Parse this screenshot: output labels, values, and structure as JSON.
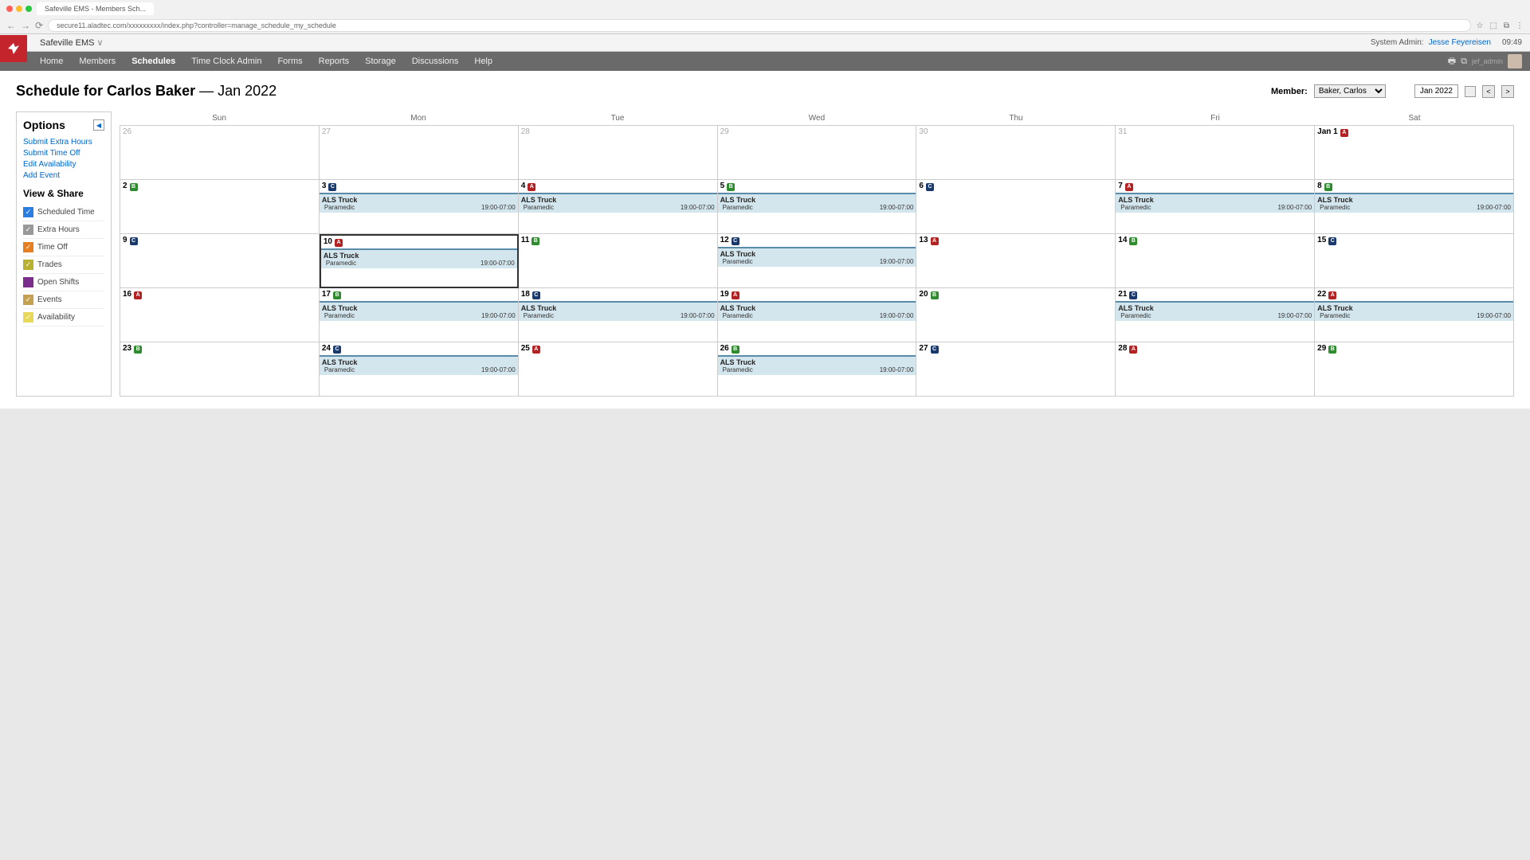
{
  "browser": {
    "tab_title": "Safeville EMS - Members Sch...",
    "url": "secure11.aladtec.com/xxxxxxxxx/index.php?controller=manage_schedule_my_schedule"
  },
  "header": {
    "org_name": "Safeville EMS",
    "system_admin_label": "System Admin:",
    "admin_name": "Jesse Feyereisen",
    "time": "09:49",
    "username_small": "jef_admin"
  },
  "nav": {
    "items": [
      "Home",
      "Members",
      "Schedules",
      "Time Clock Admin",
      "Forms",
      "Reports",
      "Storage",
      "Discussions",
      "Help"
    ],
    "active": "Schedules"
  },
  "page": {
    "title_prefix": "Schedule for Carlos Baker",
    "title_suffix": "— Jan 2022",
    "member_label": "Member:",
    "member_selected": "Baker, Carlos",
    "month_display": "Jan 2022"
  },
  "sidebar": {
    "options_title": "Options",
    "view_share_title": "View & Share",
    "links": [
      "Submit Extra Hours",
      "Submit Time Off",
      "Edit Availability",
      "Add Event"
    ],
    "filters": [
      {
        "label": "Scheduled Time",
        "color": "#2a7de1",
        "checked": true
      },
      {
        "label": "Extra Hours",
        "color": "#999999",
        "checked": true
      },
      {
        "label": "Time Off",
        "color": "#e67e22",
        "checked": true
      },
      {
        "label": "Trades",
        "color": "#b8b030",
        "checked": true
      },
      {
        "label": "Open Shifts",
        "color": "#7b2d8e",
        "checked": false
      },
      {
        "label": "Events",
        "color": "#c4a050",
        "checked": true
      },
      {
        "label": "Availability",
        "color": "#e8d858",
        "checked": true
      }
    ]
  },
  "calendar": {
    "day_headers": [
      "Sun",
      "Mon",
      "Tue",
      "Wed",
      "Thu",
      "Fri",
      "Sat"
    ],
    "shift_event": {
      "title": "ALS Truck",
      "role": "Paramedic",
      "time": "19:00-07:00"
    },
    "cells": [
      {
        "num": "26",
        "faded": true
      },
      {
        "num": "27",
        "faded": true
      },
      {
        "num": "28",
        "faded": true
      },
      {
        "num": "29",
        "faded": true
      },
      {
        "num": "30",
        "faded": true
      },
      {
        "num": "31",
        "faded": true
      },
      {
        "num": "Jan 1",
        "badge": "A"
      },
      {
        "num": "2",
        "badge": "B"
      },
      {
        "num": "3",
        "badge": "C",
        "shift": true
      },
      {
        "num": "4",
        "badge": "A",
        "shift": true
      },
      {
        "num": "5",
        "badge": "B",
        "shift": true
      },
      {
        "num": "6",
        "badge": "C"
      },
      {
        "num": "7",
        "badge": "A",
        "shift": true
      },
      {
        "num": "8",
        "badge": "B",
        "shift": true
      },
      {
        "num": "9",
        "badge": "C"
      },
      {
        "num": "10",
        "badge": "A",
        "shift": true,
        "today": true
      },
      {
        "num": "11",
        "badge": "B"
      },
      {
        "num": "12",
        "badge": "C",
        "shift": true
      },
      {
        "num": "13",
        "badge": "A"
      },
      {
        "num": "14",
        "badge": "B"
      },
      {
        "num": "15",
        "badge": "C"
      },
      {
        "num": "16",
        "badge": "A"
      },
      {
        "num": "17",
        "badge": "B",
        "shift": true
      },
      {
        "num": "18",
        "badge": "C",
        "shift": true
      },
      {
        "num": "19",
        "badge": "A",
        "shift": true
      },
      {
        "num": "20",
        "badge": "B"
      },
      {
        "num": "21",
        "badge": "C",
        "shift": true
      },
      {
        "num": "22",
        "badge": "A",
        "shift": true
      },
      {
        "num": "23",
        "badge": "B"
      },
      {
        "num": "24",
        "badge": "C",
        "shift": true
      },
      {
        "num": "25",
        "badge": "A"
      },
      {
        "num": "26",
        "badge": "B",
        "shift": true
      },
      {
        "num": "27",
        "badge": "C"
      },
      {
        "num": "28",
        "badge": "A"
      },
      {
        "num": "29",
        "badge": "B"
      }
    ]
  }
}
